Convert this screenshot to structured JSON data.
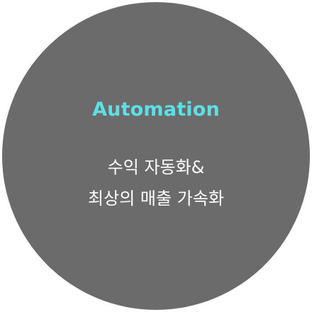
{
  "badge": {
    "heading": "Automation",
    "lines": [
      "수익 자동화&",
      "최상의 매출 가속화"
    ]
  },
  "colors": {
    "circle": "#6b6b6b",
    "accent": "#5ce0e6",
    "text": "#ffffff"
  }
}
